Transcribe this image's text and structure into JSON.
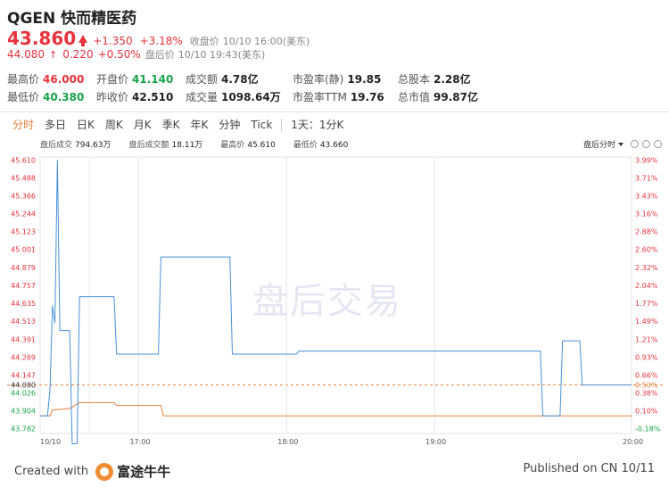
{
  "header": {
    "ticker": "QGEN",
    "name": "快而精医药",
    "price": "43.860",
    "change": "+1.350",
    "change_pct": "+3.18%",
    "close_label": "收盘价",
    "close_time": "10/10 16:00(美东)",
    "post_price": "44.080",
    "post_change": "0.220",
    "post_pct": "+0.50%",
    "post_label": "盘后价",
    "post_time": "10/10 19:43(美东)"
  },
  "stats": {
    "high_label": "最高价",
    "high": "46.000",
    "low_label": "最低价",
    "low": "40.380",
    "open_label": "开盘价",
    "open": "41.140",
    "prev_label": "昨收价",
    "prev": "42.510",
    "amount_label": "成交额",
    "amount": "4.78亿",
    "volume_label": "成交量",
    "volume": "1098.64万",
    "pe_static_label": "市盈率(静)",
    "pe_static": "19.85",
    "pe_ttm_label": "市盈率TTM",
    "pe_ttm": "19.76",
    "shares_label": "总股本",
    "shares": "2.28亿",
    "mktcap_label": "总市值",
    "mktcap": "99.87亿"
  },
  "tabs": [
    "分时",
    "多日",
    "日K",
    "周K",
    "月K",
    "季K",
    "年K",
    "分钟",
    "Tick"
  ],
  "tab_extra": "1天：1分K",
  "chart_header": {
    "post_volume_label": "盘后成交",
    "post_volume": "794.63万",
    "post_amount_label": "盘后成交额",
    "post_amount": "18.11万",
    "high_label": "最高价",
    "high": "45.610",
    "low_label": "最低价",
    "low": "43.660",
    "mode": "盘后分时"
  },
  "watermark": "盘后交易",
  "footer": {
    "created": "Created with",
    "brand": "富途牛牛",
    "published": "Published on CN 10/11"
  },
  "colors": {
    "up": "#e8323c",
    "down": "#1aa34a",
    "line": "#4a90d9",
    "avg": "#e8823c",
    "accent": "#e8823c"
  },
  "chart_data": {
    "type": "line",
    "y_ticks": [
      "45.610",
      "45.488",
      "45.366",
      "45.244",
      "45.123",
      "45.001",
      "44.879",
      "44.757",
      "44.635",
      "44.513",
      "44.391",
      "44.269",
      "44.147",
      "44.026",
      "43.904",
      "43.782"
    ],
    "pct_ticks": [
      "3.99%",
      "3.71%",
      "3.43%",
      "3.16%",
      "2.88%",
      "2.60%",
      "2.32%",
      "2.04%",
      "1.77%",
      "1.49%",
      "1.21%",
      "0.93%",
      "0.66%",
      "0.38%",
      "0.10%",
      "-0.18%"
    ],
    "ref_price": "44.080",
    "ref_pct": "0.50%",
    "x_labels": [
      "10/10",
      "17:00",
      "18:00",
      "19:00",
      "20:00"
    ],
    "ylim": [
      43.75,
      45.63
    ],
    "x_minutes": [
      0,
      240
    ],
    "price_series": [
      [
        0,
        43.87
      ],
      [
        3,
        43.87
      ],
      [
        4,
        44.05
      ],
      [
        5,
        44.62
      ],
      [
        6,
        44.5
      ],
      [
        7,
        45.61
      ],
      [
        8,
        44.45
      ],
      [
        9,
        44.45
      ],
      [
        12,
        44.45
      ],
      [
        13,
        43.68
      ],
      [
        15,
        43.68
      ],
      [
        16,
        44.68
      ],
      [
        18,
        44.68
      ],
      [
        30,
        44.68
      ],
      [
        31,
        44.29
      ],
      [
        48,
        44.29
      ],
      [
        49,
        44.95
      ],
      [
        77,
        44.95
      ],
      [
        78,
        44.29
      ],
      [
        104,
        44.29
      ],
      [
        105,
        44.31
      ],
      [
        203,
        44.31
      ],
      [
        204,
        43.87
      ],
      [
        211,
        43.87
      ],
      [
        212,
        44.38
      ],
      [
        219,
        44.38
      ],
      [
        220,
        44.08
      ],
      [
        240,
        44.08
      ]
    ],
    "avg_series": [
      [
        0,
        43.87
      ],
      [
        4,
        43.87
      ],
      [
        5,
        43.91
      ],
      [
        12,
        43.92
      ],
      [
        16,
        43.96
      ],
      [
        30,
        43.96
      ],
      [
        31,
        43.94
      ],
      [
        49,
        43.94
      ],
      [
        50,
        43.87
      ],
      [
        240,
        43.87
      ]
    ]
  }
}
